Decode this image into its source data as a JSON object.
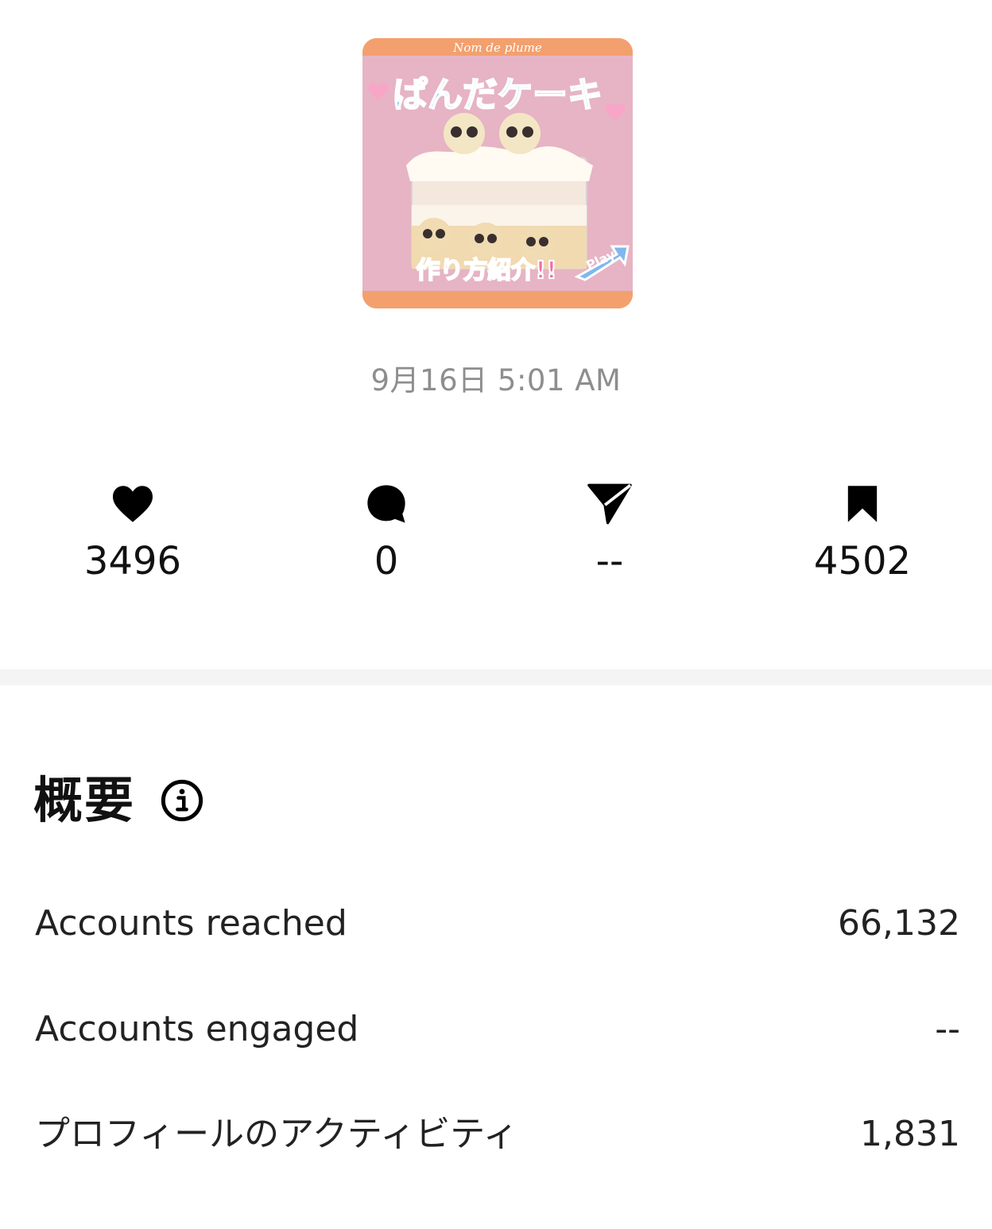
{
  "post": {
    "thumbnail": {
      "banner_text": "Nom de plume",
      "title_text": "ぱんだケーキ",
      "subtitle_text": "作り方紹介!!",
      "play_text": "Play"
    },
    "date": "9月16日 5:01 AM"
  },
  "stats": {
    "likes": {
      "icon": "heart-icon",
      "value": "3496"
    },
    "comments": {
      "icon": "comment-icon",
      "value": "0"
    },
    "shares": {
      "icon": "send-icon",
      "value": "--"
    },
    "saves": {
      "icon": "bookmark-icon",
      "value": "4502"
    }
  },
  "overview": {
    "title": "概要",
    "info_icon": "info-icon",
    "rows": [
      {
        "label": "Accounts reached",
        "value": "66,132"
      },
      {
        "label": "Accounts engaged",
        "value": "--"
      },
      {
        "label": "プロフィールのアクティビティ",
        "value": "1,831"
      }
    ]
  },
  "colors": {
    "background": "#ffffff",
    "date_text": "#8e8e8e",
    "divider": "#f4f4f4",
    "thumbnail_frame": "#f3a06e",
    "thumbnail_bg": "#e8b7c6"
  }
}
